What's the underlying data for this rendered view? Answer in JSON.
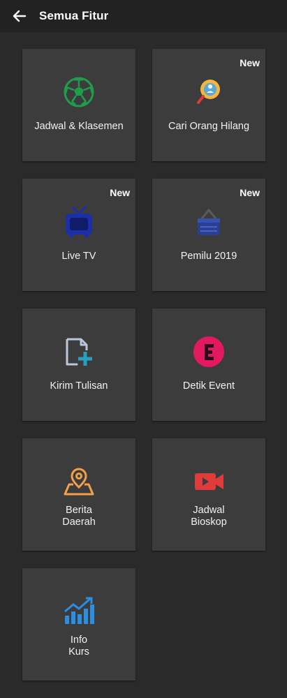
{
  "header": {
    "title": "Semua Fitur"
  },
  "badge_new": "New",
  "tiles": [
    {
      "label": "Jadwal & Klasemen",
      "icon": "soccer-ball-icon",
      "new": false
    },
    {
      "label": "Cari Orang Hilang",
      "icon": "magnifier-search-icon",
      "new": true
    },
    {
      "label": "Live TV",
      "icon": "tv-icon",
      "new": true
    },
    {
      "label": "Pemilu 2019",
      "icon": "ballot-box-icon",
      "new": true
    },
    {
      "label": "Kirim Tulisan",
      "icon": "document-add-icon",
      "new": false
    },
    {
      "label": "Detik Event",
      "icon": "event-e-icon",
      "new": false
    },
    {
      "label": "Berita\nDaerah",
      "icon": "map-pin-icon",
      "new": false
    },
    {
      "label": "Jadwal\nBioskop",
      "icon": "video-camera-icon",
      "new": false
    },
    {
      "label": "Info\nKurs",
      "icon": "chart-growth-icon",
      "new": false
    }
  ],
  "colors": {
    "background": "#2a2a2a",
    "appbar": "#222222",
    "tile": "#3c3c3c",
    "soccer": "#1e9e4a",
    "search": "#f4b63f",
    "tv": "#1c2fa6",
    "pemilu": "#2a3f8f",
    "document": "#b9c7d8",
    "event": "#e2195f",
    "pin": "#f2a04a",
    "camera": "#e03b3b",
    "chart": "#2b8ee0"
  }
}
